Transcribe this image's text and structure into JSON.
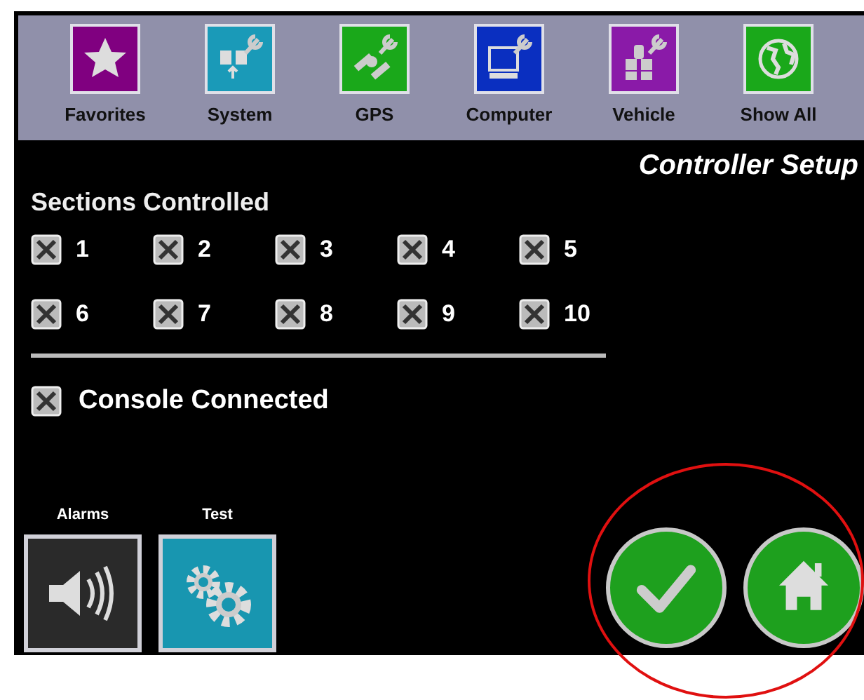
{
  "toolbar": [
    {
      "label": "Favorites",
      "kind": "favorites",
      "color": "#800080"
    },
    {
      "label": "System",
      "kind": "system",
      "color": "#1a9ab8"
    },
    {
      "label": "GPS",
      "kind": "gps",
      "color": "#1aa81a"
    },
    {
      "label": "Computer",
      "kind": "computer",
      "color": "#0a2fc0"
    },
    {
      "label": "Vehicle",
      "kind": "vehicle",
      "color": "#8a1aa8"
    },
    {
      "label": "Show All",
      "kind": "globe",
      "color": "#1aa81a"
    }
  ],
  "title": "Controller Setup",
  "sections": {
    "heading": "Sections Controlled",
    "items": [
      {
        "label": "1",
        "checked": true
      },
      {
        "label": "2",
        "checked": true
      },
      {
        "label": "3",
        "checked": true
      },
      {
        "label": "4",
        "checked": true
      },
      {
        "label": "5",
        "checked": true
      },
      {
        "label": "6",
        "checked": true
      },
      {
        "label": "7",
        "checked": true
      },
      {
        "label": "8",
        "checked": true
      },
      {
        "label": "9",
        "checked": true
      },
      {
        "label": "10",
        "checked": true
      }
    ]
  },
  "console": {
    "label": "Console Connected",
    "checked": true
  },
  "tools": [
    {
      "label": "Alarms",
      "kind": "speaker"
    },
    {
      "label": "Test",
      "kind": "gears"
    }
  ],
  "actions": [
    {
      "kind": "accept"
    },
    {
      "kind": "home"
    }
  ]
}
